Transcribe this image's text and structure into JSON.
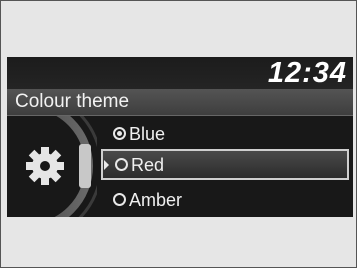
{
  "header": {
    "clock": "12:34"
  },
  "menu": {
    "title": "Colour theme",
    "options": [
      {
        "label": "Blue",
        "checked": true,
        "highlighted": false
      },
      {
        "label": "Red",
        "checked": false,
        "highlighted": true
      },
      {
        "label": "Amber",
        "checked": false,
        "highlighted": false
      }
    ],
    "settings_icon": "gear-icon"
  }
}
